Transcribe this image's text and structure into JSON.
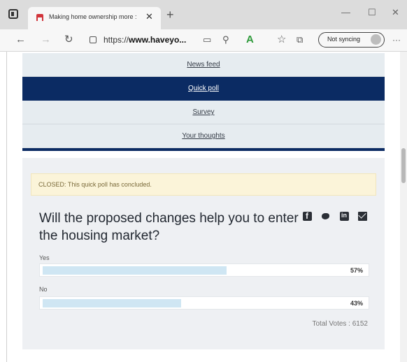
{
  "browser": {
    "tab_title": "Making home ownership more :",
    "tab_close": "✕",
    "new_tab": "+",
    "window_minimize": "—",
    "window_maximize": "☐",
    "window_close": "✕",
    "url_prefix": "https://",
    "url_host": "www.haveyo...",
    "sync_label": "Not syncing",
    "more_menu": "···",
    "icons": [
      "tab-actions-icon",
      "back-icon",
      "forward-icon",
      "refresh-icon",
      "lock-icon",
      "reader-view-icon",
      "extension-icon",
      "adblock-icon",
      "favorites-icon",
      "collections-icon",
      "profile-icon"
    ]
  },
  "nav": {
    "items": [
      {
        "label": "News feed",
        "active": false
      },
      {
        "label": "Quick poll",
        "active": true
      },
      {
        "label": "Survey",
        "active": false
      },
      {
        "label": "Your thoughts",
        "active": false
      }
    ]
  },
  "poll": {
    "closed_notice": "CLOSED: This quick poll has concluded.",
    "question": "Will the proposed changes help you to enter the housing market?",
    "options": [
      {
        "label": "Yes",
        "percent_label": "57%",
        "percent": 57
      },
      {
        "label": "No",
        "percent_label": "43%",
        "percent": 43
      }
    ],
    "total_votes": "Total Votes : 6152",
    "share_icons": [
      "facebook-icon",
      "twitter-icon",
      "linkedin-icon",
      "email-icon"
    ]
  },
  "colors": {
    "nav_active": "#0b2b63",
    "nav_bg": "#e6ecf0",
    "bar_fill": "#cfe6f3",
    "banner_bg": "#fbf4d9"
  }
}
